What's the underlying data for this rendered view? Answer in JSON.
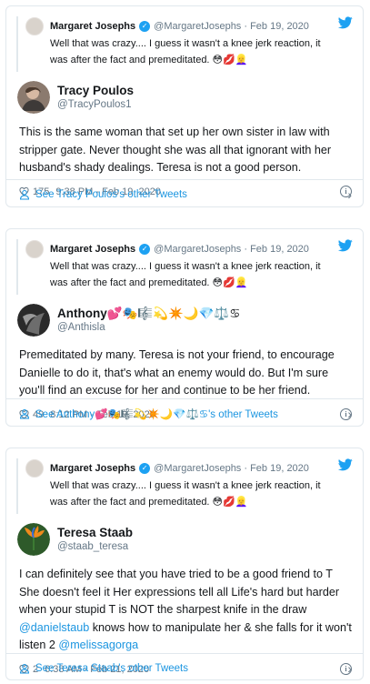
{
  "tweets": [
    {
      "quoted": {
        "name": "Margaret Josephs",
        "handle": "@MargaretJosephs · Feb 19, 2020",
        "text": "Well that was crazy.... I guess it wasn't a knee jerk reaction, it was after the fact and premeditated. 😳💋👱‍♀️"
      },
      "author": {
        "name": "Tracy Poulos",
        "handle": "@TracyPoulos1"
      },
      "text": "This is the same woman that set up her own sister in law with stripper gate. Never thought she was all that ignorant with her husband's shady dealings. Teresa is not a good person.",
      "likes": "175",
      "timestamp": "9:38 PM - Feb 19, 2020",
      "footer": "See Tracy Poulos's other Tweets"
    },
    {
      "quoted": {
        "name": "Margaret Josephs",
        "handle": "@MargaretJosephs · Feb 19, 2020",
        "text": "Well that was crazy.... I guess it wasn't a knee jerk reaction, it was after the fact and premeditated. 😳💋👱‍♀️"
      },
      "author": {
        "name": "Anthony💕🎭🎼💫✴️🌙💎⚖️♋",
        "handle": "@Anthisla"
      },
      "text": "Premeditated by many. Teresa is not your friend, to encourage Danielle to do it, that's what an enemy would do. But I'm sure you'll find an excuse for her and continue to be her friend.",
      "likes": "49",
      "timestamp": "8:12 PM - Feb 19, 2020",
      "footer": "See Anthony💕🎭🎼💫✴️🌙💎⚖️♋'s other Tweets"
    },
    {
      "quoted": {
        "name": "Margaret Josephs",
        "handle": "@MargaretJosephs · Feb 19, 2020",
        "text": "Well that was crazy.... I guess it wasn't a knee jerk reaction, it was after the fact and premeditated. 😳💋👱‍♀️"
      },
      "author": {
        "name": "Teresa Staab",
        "handle": "@staab_teresa"
      },
      "text_parts": [
        "I can definitely see that you have tried to be a good friend to T She doesn't feel it Her expressions tell all Life's hard but harder when your stupid T is NOT the sharpest knife in the draw ",
        "@danielstaub",
        " knows how to manipulate her & she falls for it won't listen 2 ",
        "@melissagorga"
      ],
      "likes": "2",
      "timestamp": "6:38 AM - Feb 21, 2020",
      "footer": "See Teresa Staab's other Tweets"
    }
  ],
  "colors": {
    "link": "#1b95e0",
    "muted": "#657786",
    "verified": "#1da1f2",
    "border": "#e1e8ed"
  }
}
